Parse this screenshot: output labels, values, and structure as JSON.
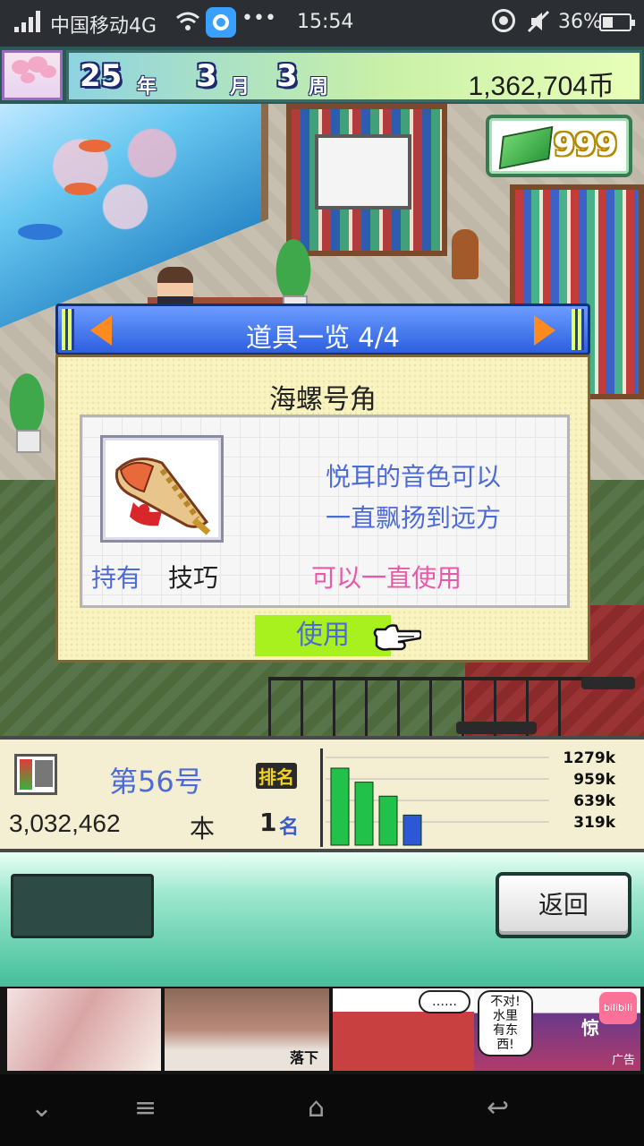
{
  "status_bar": {
    "carrier": "中国移动4G",
    "dots": "•••",
    "time": "15:54",
    "battery": "36%"
  },
  "top_bar": {
    "year": "25",
    "year_unit": "年",
    "month": "3",
    "month_unit": "月",
    "week": "3",
    "week_unit": "周",
    "money": "1,362,704币"
  },
  "item_counter": {
    "count": "999",
    "icon": "book-stack-icon"
  },
  "dialog": {
    "title": "道具一览 4/4",
    "item_name": "海螺号角",
    "description_line1": "悦耳的音色可以",
    "description_line2": "一直飘扬到远方",
    "owned_label": "持有",
    "item_type": "技巧",
    "usage": "可以一直使用",
    "use_button": "使用",
    "item_icon": "conch-horn-icon"
  },
  "info_panel": {
    "issue": "第56号",
    "rank_badge": "排名",
    "sales": "3,032,462",
    "sales_unit": "本",
    "rank_number": "1",
    "rank_suffix": "名"
  },
  "chart_data": {
    "type": "bar",
    "y_tick_labels": [
      "1279k",
      "959k",
      "639k",
      "319k"
    ],
    "ylim": [
      0,
      1279
    ],
    "values": [
      1100,
      900,
      700,
      430
    ],
    "colors": [
      "#22c24a",
      "#22c24a",
      "#22c24a",
      "#2e57d6"
    ]
  },
  "bottom_bar": {
    "back_button": "返回"
  },
  "ad_banner": {
    "bubble1": "……",
    "bubble2_line1": "不对!",
    "bubble2_line2": "水里",
    "bubble2_line3": "有东西!",
    "panel2_caption": "落下",
    "panel4_caption": "惊",
    "logo": "bilibili",
    "ad_label": "广告"
  },
  "nav_bar": {
    "down": "⌄",
    "menu": "≡",
    "home": "⌂",
    "back": "↩"
  }
}
